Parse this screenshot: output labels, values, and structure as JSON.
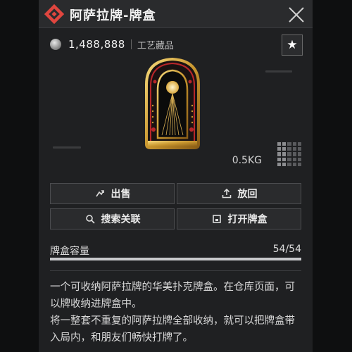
{
  "header": {
    "title": "阿萨拉牌-牌盒",
    "logo_icon": "diamond-logo-icon",
    "close_icon": "close-icon",
    "accent": "#e0463f"
  },
  "info": {
    "price": "1,488,888",
    "currency_icon": "silver-coin-icon",
    "category": "工艺藏品",
    "favorite_icon": "star-icon"
  },
  "item": {
    "image_icon": "card-box-icon",
    "weight": "0.5KG",
    "size_icon": "inventory-grid-icon",
    "grid_filled_fraction": 0.4
  },
  "actions": {
    "sell": "出售",
    "put_back": "放回",
    "search_related": "搜索关联",
    "open_box": "打开牌盒"
  },
  "capacity": {
    "label": "牌盒容量",
    "value": "54/54",
    "current": 54,
    "max": 54
  },
  "description": {
    "line1": "一个可收纳阿萨拉牌的华美扑克牌盒。在仓库页面，可以牌收纳进牌盒中。",
    "line2": "将一整套不重复的阿萨拉牌全部收纳，就可以把牌盒带入局内，和朋友们畅快打牌了。"
  }
}
